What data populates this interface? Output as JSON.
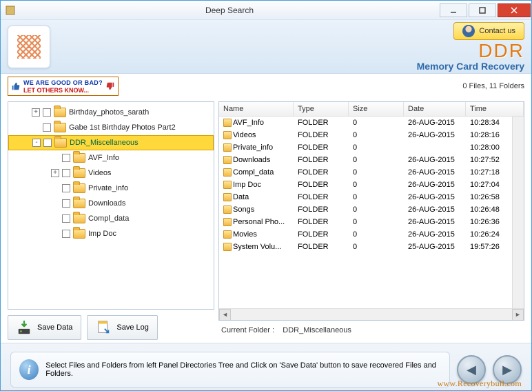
{
  "window": {
    "title": "Deep Search"
  },
  "header": {
    "contact_label": "Contact us",
    "brand_top": "DDR",
    "brand_sub": "Memory Card Recovery"
  },
  "feedback": {
    "line1": "WE ARE GOOD OR BAD?",
    "line2": "LET OTHERS KNOW..."
  },
  "status": "0 Files, 11 Folders",
  "tree": [
    {
      "label": "Birthday_photos_sarath",
      "depth": 1,
      "expander": "+",
      "checked": false
    },
    {
      "label": "Gabe 1st Birthday Photos Part2",
      "depth": 1,
      "expander": "",
      "checked": false
    },
    {
      "label": "DDR_Miscellaneous",
      "depth": 1,
      "expander": "-",
      "checked": false,
      "selected": true
    },
    {
      "label": "AVF_Info",
      "depth": 2,
      "expander": "",
      "checked": false
    },
    {
      "label": "Videos",
      "depth": 2,
      "expander": "+",
      "checked": false
    },
    {
      "label": "Private_info",
      "depth": 2,
      "expander": "",
      "checked": false
    },
    {
      "label": "Downloads",
      "depth": 2,
      "expander": "",
      "checked": false
    },
    {
      "label": "Compl_data",
      "depth": 2,
      "expander": "",
      "checked": false
    },
    {
      "label": "Imp Doc",
      "depth": 2,
      "expander": "",
      "checked": false
    }
  ],
  "buttons": {
    "save_data": "Save Data",
    "save_log": "Save Log"
  },
  "list": {
    "headers": {
      "name": "Name",
      "type": "Type",
      "size": "Size",
      "date": "Date",
      "time": "Time"
    },
    "rows": [
      {
        "name": "AVF_Info",
        "type": "FOLDER",
        "size": "0",
        "date": "26-AUG-2015",
        "time": "10:28:34"
      },
      {
        "name": "Videos",
        "type": "FOLDER",
        "size": "0",
        "date": "26-AUG-2015",
        "time": "10:28:16"
      },
      {
        "name": "Private_info",
        "type": "FOLDER",
        "size": "0",
        "date": "",
        "time": "10:28:00"
      },
      {
        "name": "Downloads",
        "type": "FOLDER",
        "size": "0",
        "date": "26-AUG-2015",
        "time": "10:27:52"
      },
      {
        "name": "Compl_data",
        "type": "FOLDER",
        "size": "0",
        "date": "26-AUG-2015",
        "time": "10:27:18"
      },
      {
        "name": "Imp Doc",
        "type": "FOLDER",
        "size": "0",
        "date": "26-AUG-2015",
        "time": "10:27:04"
      },
      {
        "name": "Data",
        "type": "FOLDER",
        "size": "0",
        "date": "26-AUG-2015",
        "time": "10:26:58"
      },
      {
        "name": "Songs",
        "type": "FOLDER",
        "size": "0",
        "date": "26-AUG-2015",
        "time": "10:26:48"
      },
      {
        "name": "Personal Pho...",
        "type": "FOLDER",
        "size": "0",
        "date": "26-AUG-2015",
        "time": "10:26:36"
      },
      {
        "name": "Movies",
        "type": "FOLDER",
        "size": "0",
        "date": "26-AUG-2015",
        "time": "10:26:24"
      },
      {
        "name": "System Volu...",
        "type": "FOLDER",
        "size": "0",
        "date": "25-AUG-2015",
        "time": "19:57:26"
      }
    ]
  },
  "current_folder_label": "Current Folder :",
  "current_folder_value": "DDR_Miscellaneous",
  "footer": {
    "hint": "Select Files and Folders from left Panel Directories Tree and Click on 'Save Data' button to save recovered Files and Folders.",
    "url": "www.Recoverybull.com"
  }
}
